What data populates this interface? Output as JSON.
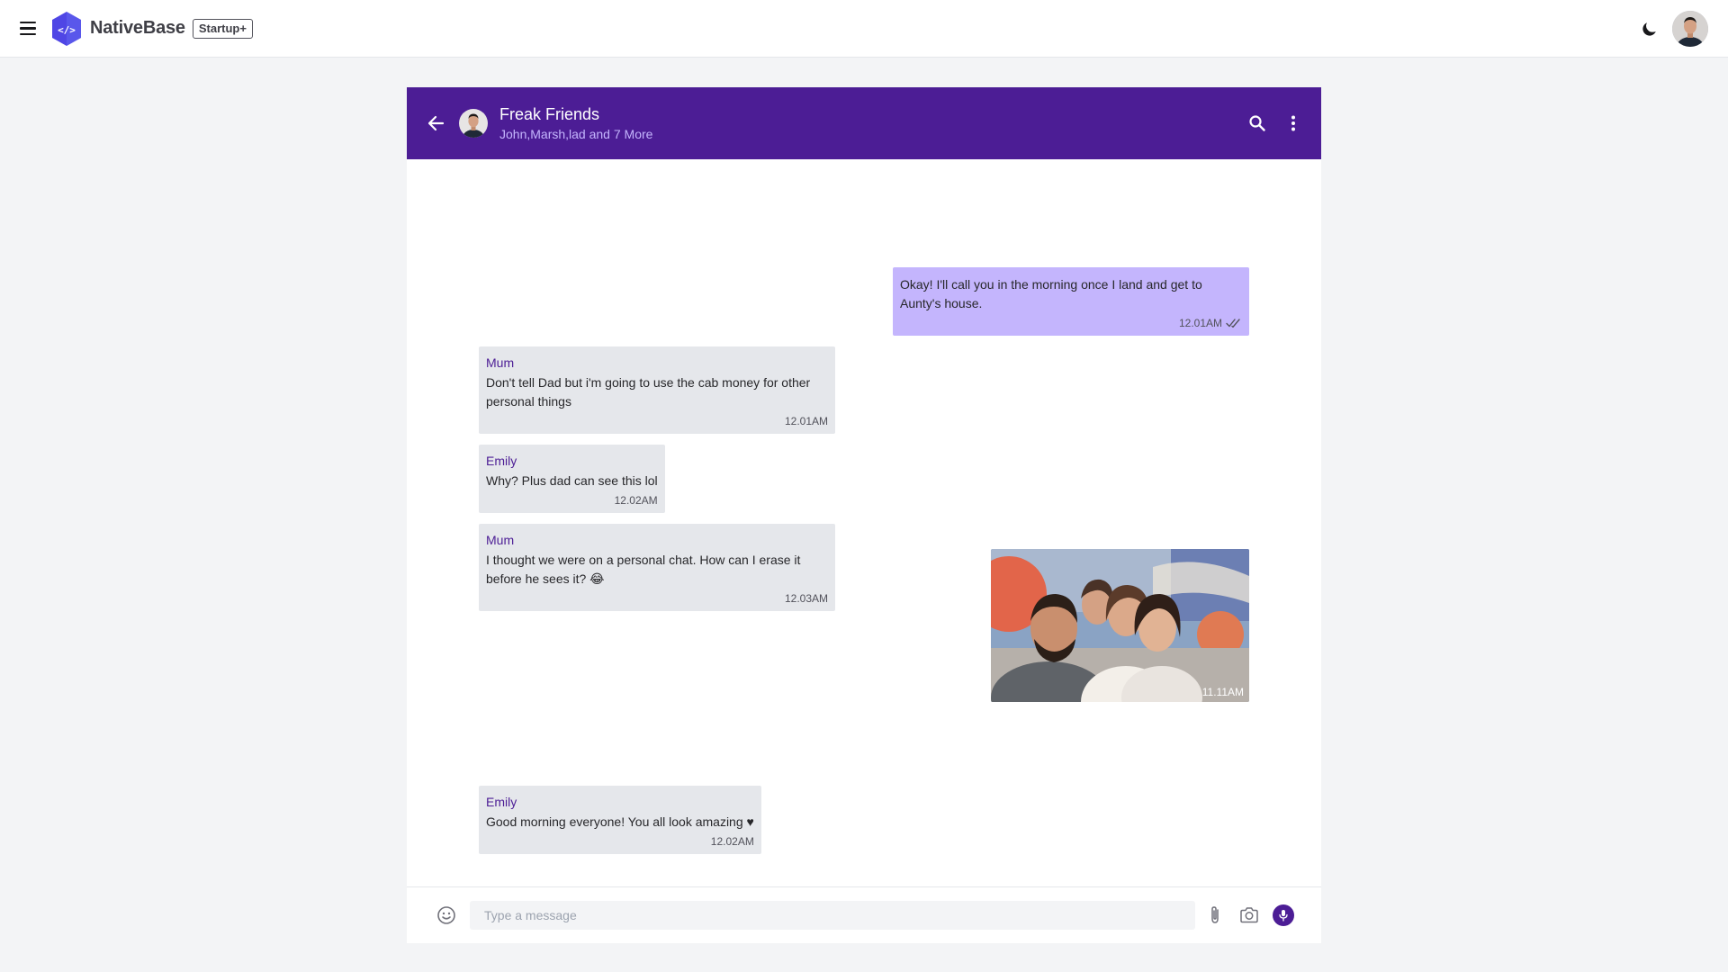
{
  "navbar": {
    "brand": "NativeBase",
    "plan_badge": "Startup+",
    "icons": [
      "menu-icon",
      "nativebase-logo",
      "moon-icon",
      "user-avatar"
    ]
  },
  "chat": {
    "group_name": "Freak Friends",
    "members": "John,Marsh,lad and 7 More",
    "header_icons": [
      "arrow-left-icon",
      "search-icon",
      "kebab-menu-icon"
    ],
    "accent_color": "#4c1d95",
    "messages": [
      {
        "direction": "out",
        "text": "Okay! I'll call you in the morning once I land and get to Aunty's house.",
        "time": "12.01AM",
        "status": "read-ticks"
      },
      {
        "direction": "in",
        "sender": "Mum",
        "text": "Don't tell Dad but i'm going to use the cab money for other personal things",
        "time": "12.01AM"
      },
      {
        "direction": "in",
        "sender": "Emily",
        "text": "Why? Plus dad can see this lol",
        "time": "12.02AM"
      },
      {
        "direction": "in",
        "sender": "Mum",
        "text": "I thought we were on a personal chat. How can I erase it before he sees it? 😂",
        "time": "12.03AM"
      },
      {
        "direction": "out",
        "type": "photo",
        "time": "11.11AM"
      },
      {
        "direction": "in",
        "sender": "Emily",
        "text": "Good morning everyone! You all look amazing ♥",
        "time": "12.02AM"
      }
    ]
  },
  "composer": {
    "placeholder": "Type a message",
    "icons": [
      "emoji-icon",
      "paperclip-icon",
      "camera-icon",
      "mic-icon"
    ]
  }
}
